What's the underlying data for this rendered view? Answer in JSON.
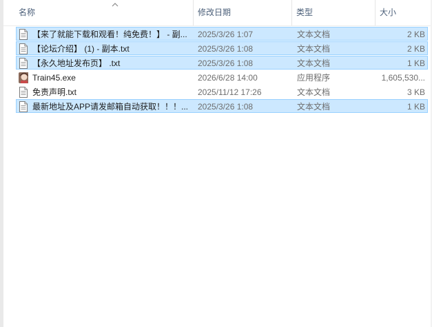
{
  "header": {
    "name_label": "名称",
    "date_label": "修改日期",
    "type_label": "类型",
    "size_label": "大小",
    "sort_icon": "sort-ascending-chevron-icon"
  },
  "files": [
    {
      "name": "【来了就能下载和观看！纯免费！】 - 副...",
      "date": "2025/3/26 1:07",
      "type": "文本文档",
      "size": "2 KB",
      "icon": "text-file-icon",
      "selected": true
    },
    {
      "name": "【论坛介绍】 (1) - 副本.txt",
      "date": "2025/3/26 1:08",
      "type": "文本文档",
      "size": "2 KB",
      "icon": "text-file-icon",
      "selected": true
    },
    {
      "name": "【永久地址发布页】 .txt",
      "date": "2025/3/26 1:08",
      "type": "文本文档",
      "size": "1 KB",
      "icon": "text-file-icon",
      "selected": true
    },
    {
      "name": "Train45.exe",
      "date": "2026/6/28 14:00",
      "type": "应用程序",
      "size": "1,605,530...",
      "icon": "app-avatar-icon",
      "selected": false
    },
    {
      "name": "免责声明.txt",
      "date": "2025/11/12 17:26",
      "type": "文本文档",
      "size": "3 KB",
      "icon": "text-file-icon",
      "selected": false
    },
    {
      "name": "最新地址及APP请发邮箱自动获取！！！...",
      "date": "2025/3/26 1:08",
      "type": "文本文档",
      "size": "1 KB",
      "icon": "text-file-icon",
      "selected": true
    }
  ],
  "colors": {
    "selection_bg": "#cce8ff",
    "selection_border": "#99d1ff",
    "header_text": "#4c607a"
  }
}
